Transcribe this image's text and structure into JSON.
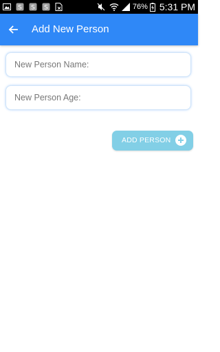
{
  "status_bar": {
    "left_icons": [
      "image-icon",
      "app-s-icon",
      "app-s-icon",
      "app-s-icon",
      "file-x-icon"
    ],
    "mute_icon": "mute-icon",
    "wifi_icon": "wifi-icon",
    "signal_icon": "signal-icon",
    "battery_percent": "76%",
    "battery_icon": "battery-charging-icon",
    "time": "5:31 PM"
  },
  "app_bar": {
    "back_icon": "arrow-left-icon",
    "title": "Add New Person",
    "color": "#2f88f7"
  },
  "form": {
    "name_field": {
      "placeholder": "New Person Name:",
      "value": ""
    },
    "age_field": {
      "placeholder": "New Person Age:",
      "value": ""
    }
  },
  "add_button": {
    "label": "ADD PERSON",
    "icon": "plus-circle-icon",
    "color": "#82cfe6"
  }
}
